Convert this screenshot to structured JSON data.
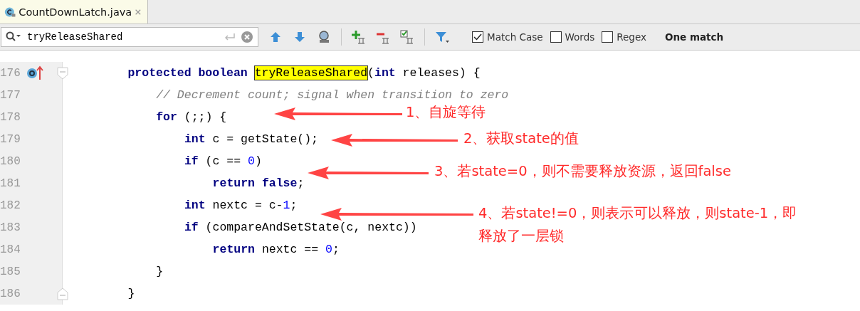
{
  "tabs": [
    {
      "label": "CountDownLatch.java",
      "selected": true
    }
  ],
  "search": {
    "value": "tryReleaseShared",
    "options": [
      {
        "label": "Match Case",
        "checked": true
      },
      {
        "label": "Words",
        "checked": false
      },
      {
        "label": "Regex",
        "checked": false
      }
    ],
    "result": "One match"
  },
  "lines": [
    {
      "number": "176",
      "override": true,
      "fold": true,
      "tokens": [
        {
          "kind": "keyword",
          "text": "protected boolean"
        },
        {
          "kind": "match",
          "text": "tryReleaseShared"
        },
        {
          "kind": "plain",
          "text": "("
        },
        {
          "kind": "keyword",
          "text": "int"
        },
        {
          "kind": "plain",
          "text": " releases) {"
        }
      ],
      "children": [
        {
          "number": "177",
          "tokens": [
            {
              "kind": "comment",
              "text": "// Decrement count; signal when transition to zero"
            }
          ]
        },
        {
          "number": "178",
          "tokens": [
            {
              "kind": "keyword",
              "text": "for"
            },
            {
              "kind": "plain",
              "text": " (;;) {"
            }
          ],
          "children": [
            {
              "number": "179",
              "tokens": [
                {
                  "kind": "keyword",
                  "text": "int"
                },
                {
                  "kind": "plain",
                  "text": " c = getState();"
                }
              ]
            },
            {
              "number": "180",
              "tokens": [
                {
                  "kind": "keyword",
                  "text": "if"
                },
                {
                  "kind": "plain",
                  "text": " (c == "
                },
                {
                  "kind": "number",
                  "text": "0"
                },
                {
                  "kind": "plain",
                  "text": ")"
                }
              ],
              "children": [
                {
                  "number": "181",
                  "tokens": [
                    {
                      "kind": "keyword",
                      "text": "return false"
                    },
                    {
                      "kind": "plain",
                      "text": ";"
                    }
                  ]
                }
              ]
            },
            {
              "number": "182",
              "tokens": [
                {
                  "kind": "keyword",
                  "text": "int"
                },
                {
                  "kind": "plain",
                  "text": " nextc = c-"
                },
                {
                  "kind": "number",
                  "text": "1"
                },
                {
                  "kind": "plain",
                  "text": ";"
                }
              ]
            },
            {
              "number": "183",
              "tokens": [
                {
                  "kind": "keyword",
                  "text": "if"
                },
                {
                  "kind": "plain",
                  "text": " (compareAndSetState(c, nextc))"
                }
              ],
              "children": [
                {
                  "number": "184",
                  "tokens": [
                    {
                      "kind": "keyword",
                      "text": "return"
                    },
                    {
                      "kind": "plain",
                      "text": " nextc == "
                    },
                    {
                      "kind": "number",
                      "text": "0"
                    },
                    {
                      "kind": "plain",
                      "text": ";"
                    }
                  ]
                }
              ]
            }
          ]
        },
        {
          "number": "185",
          "tokens": [
            {
              "kind": "plain",
              "text": "}"
            }
          ]
        }
      ]
    },
    {
      "number": "186",
      "fold": true,
      "tokens": [
        {
          "kind": "plain",
          "text": "}"
        }
      ]
    }
  ],
  "annotations": [
    {
      "lines": [
        "1、自旋等待"
      ]
    },
    {
      "lines": [
        "2、获取state的值"
      ]
    },
    {
      "lines": [
        "3、若state=0，则不需要释放资源，返回false"
      ]
    },
    {
      "lines": [
        "4、若state!=0，则表示可以释放，则state-1，即",
        "释放了一层锁"
      ]
    }
  ]
}
